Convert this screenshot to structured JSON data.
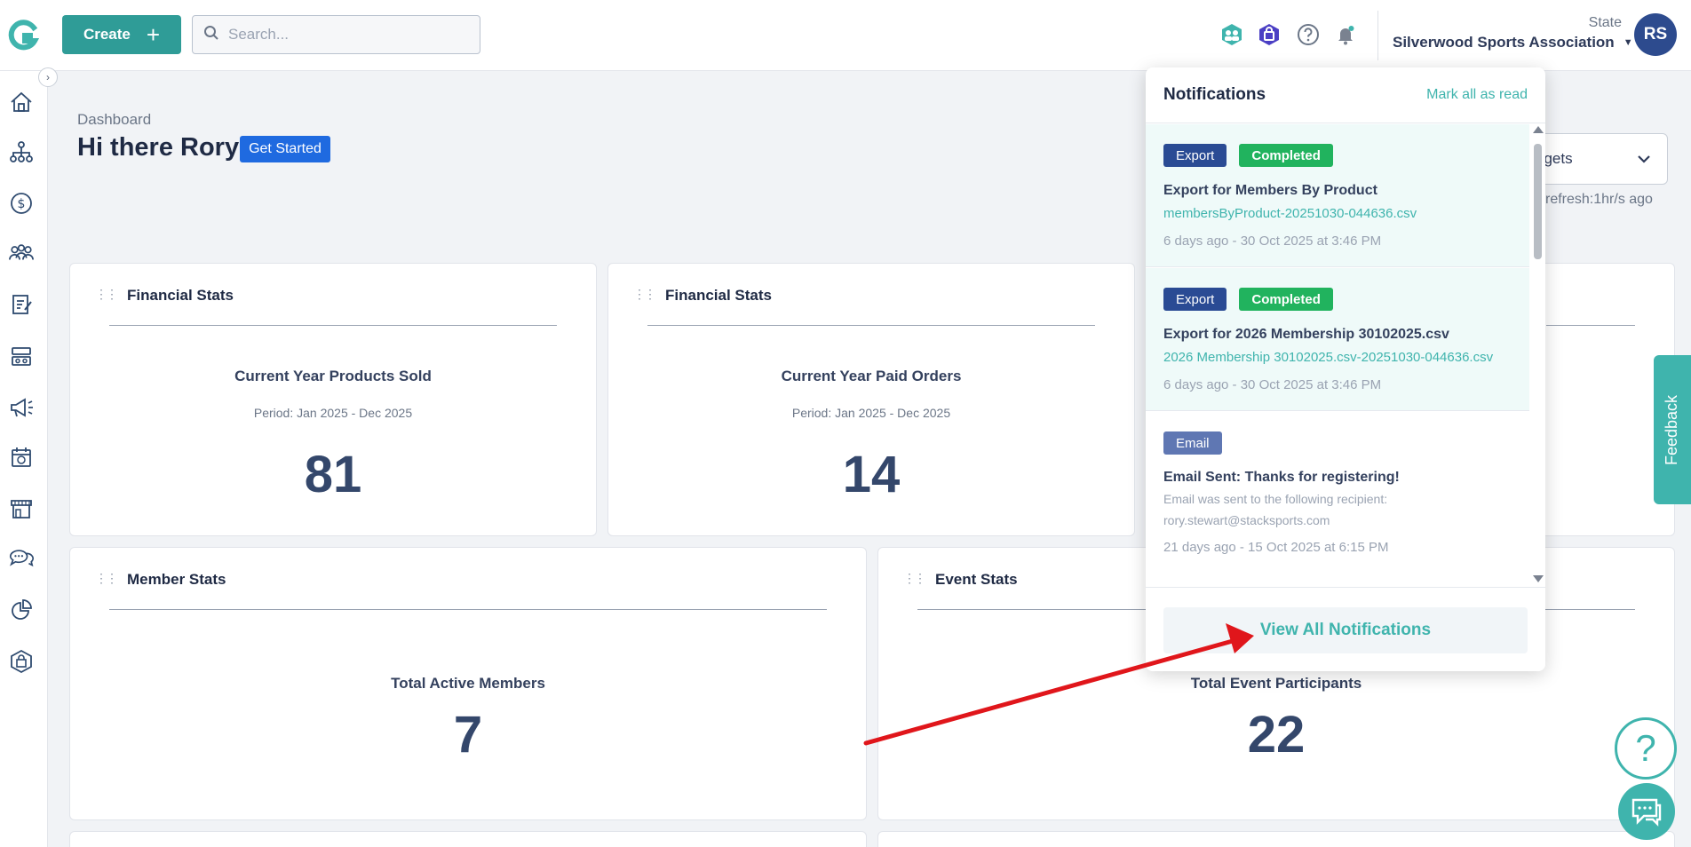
{
  "topbar": {
    "create_label": "Create",
    "create_plus": "+",
    "search_placeholder": "Search...",
    "state_label": "State",
    "org_name": "Silverwood Sports Association",
    "avatar_initials": "RS"
  },
  "header": {
    "breadcrumb": "Dashboard",
    "greeting": "Hi there Rory",
    "get_started": "Get Started",
    "widgets_label": "dgets",
    "refresh": "refresh:1hr/s ago"
  },
  "cards": [
    {
      "title": "Financial Stats",
      "label": "Current Year Products Sold",
      "period": "Period: Jan 2025 - Dec 2025",
      "value": "81"
    },
    {
      "title": "Financial Stats",
      "label": "Current Year Paid Orders",
      "period": "Period: Jan 2025 - Dec 2025",
      "value": "14"
    },
    {
      "title": "Member Stats",
      "label": "Total Active Members",
      "value": "7"
    },
    {
      "title": "Event Stats",
      "label": "Total Event Participants",
      "value": "22"
    }
  ],
  "notifications": {
    "title": "Notifications",
    "mark_all": "Mark all as read",
    "view_all": "View All Notifications",
    "items": [
      {
        "tag1": "Export",
        "tag2": "Completed",
        "title": "Export for Members By Product",
        "file": "membersByProduct-20251030-044636.csv",
        "time": "6 days ago - 30 Oct 2025 at 3:46 PM"
      },
      {
        "tag1": "Export",
        "tag2": "Completed",
        "title": "Export for 2026 Membership 30102025.csv",
        "file": "2026 Membership 30102025.csv-20251030-044636.csv",
        "time": "6 days ago - 30 Oct 2025 at 3:46 PM"
      },
      {
        "tag1": "Email",
        "title": "Email Sent: Thanks for registering!",
        "desc": "Email was sent to the following recipient: rory.stewart@stacksports.com",
        "time": "21 days ago - 15 Oct 2025 at 6:15 PM"
      }
    ]
  },
  "feedback_label": "Feedback",
  "help_glyph": "?",
  "colors": {
    "teal": "#3fb4ad",
    "create": "#2f9c97",
    "navy": "#2a4b94",
    "green": "#21b35e",
    "arrow": "#e0161b"
  }
}
